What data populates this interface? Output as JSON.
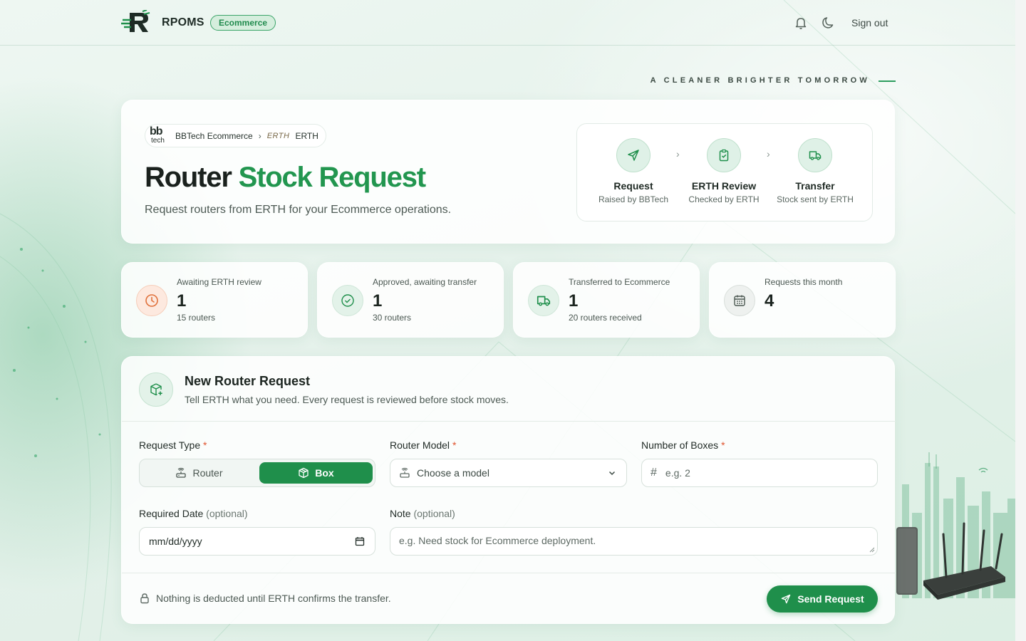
{
  "topbar": {
    "brand": "RPOMS",
    "badge": "Ecommerce",
    "sign_out": "Sign out"
  },
  "tagline": "A CLEANER BRIGHTER TOMORROW",
  "hero": {
    "breadcrumb": {
      "from_logo": "bb tech",
      "from": "BBTech Ecommerce",
      "to_logo": "ERTH",
      "to": "ERTH"
    },
    "title_main": "Router",
    "title_accent": "Stock Request",
    "subtitle": "Request routers from ERTH for your Ecommerce operations.",
    "steps": [
      {
        "title": "Request",
        "sub": "Raised by BBTech"
      },
      {
        "title": "ERTH Review",
        "sub": "Checked by ERTH"
      },
      {
        "title": "Transfer",
        "sub": "Stock sent by ERTH"
      }
    ]
  },
  "stats": [
    {
      "label": "Awaiting ERTH review",
      "value": "1",
      "sub": "15 routers"
    },
    {
      "label": "Approved, awaiting transfer",
      "value": "1",
      "sub": "30 routers"
    },
    {
      "label": "Transferred to Ecommerce",
      "value": "1",
      "sub": "20 routers received"
    },
    {
      "label": "Requests this month",
      "value": "4",
      "sub": ""
    }
  ],
  "form": {
    "title": "New Router Request",
    "subtitle": "Tell ERTH what you need. Every request is reviewed before stock moves.",
    "request_type": {
      "label": "Request Type",
      "required_mark": "*",
      "options": [
        "Router",
        "Box"
      ],
      "selected": "Box"
    },
    "router_model": {
      "label": "Router Model",
      "required_mark": "*",
      "placeholder": "Choose a model"
    },
    "boxes": {
      "label": "Number of Boxes",
      "required_mark": "*",
      "placeholder": "e.g. 2"
    },
    "date": {
      "label": "Required Date",
      "optional": "(optional)",
      "placeholder": "mm/dd/yyyy"
    },
    "note": {
      "label": "Note",
      "optional": "(optional)",
      "placeholder": "e.g. Need stock for Ecommerce deployment."
    },
    "footer_note": "Nothing is deducted until ERTH confirms the transfer.",
    "submit": "Send Request"
  },
  "colors": {
    "accent": "#1f8f4b",
    "accent_light": "#22964f",
    "required": "#e0542f",
    "warning_icon": "#e0703a"
  },
  "icons": {
    "bell": "bell-icon",
    "theme": "moon-icon",
    "request": "send-icon",
    "review": "clipboard-check-icon",
    "transfer": "truck-icon",
    "calendar": "calendar-icon",
    "lock": "lock-icon"
  }
}
